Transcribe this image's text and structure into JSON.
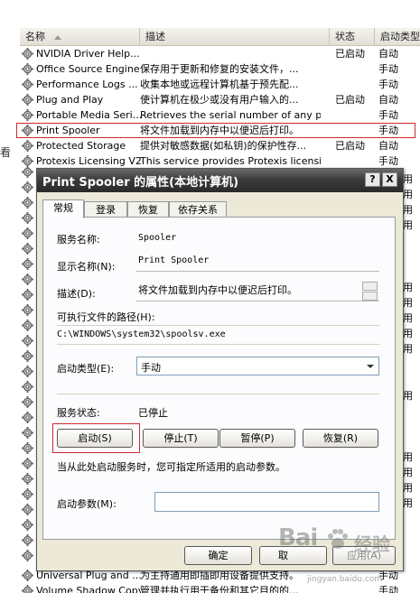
{
  "edge_char": "看",
  "columns": {
    "name": "名称",
    "desc": "描述",
    "status": "状态",
    "startup": "启动类型"
  },
  "rows": [
    {
      "name": "NVIDIA Driver Help...",
      "desc": "",
      "status": "已启动",
      "startup": "自动"
    },
    {
      "name": "Office Source Engine",
      "desc": "保存用于更新和修复的安装文件，...",
      "status": "",
      "startup": "手动"
    },
    {
      "name": "Performance Logs ...",
      "desc": "收集本地或远程计算机基于预先配...",
      "status": "",
      "startup": "手动"
    },
    {
      "name": "Plug and Play",
      "desc": "使计算机在极少或没有用户输入的...",
      "status": "已启动",
      "startup": "自动"
    },
    {
      "name": "Portable Media Seri...",
      "desc": "Retrieves the serial number of any port...",
      "status": "",
      "startup": "手动"
    },
    {
      "name": "Print Spooler",
      "desc": "将文件加载到内存中以便迟后打印。",
      "status": "",
      "startup": "手动"
    },
    {
      "name": "Protected Storage",
      "desc": "提供对敏感数据(如私钥)的保护性存...",
      "status": "已启动",
      "startup": "自动"
    },
    {
      "name": "Protexis Licensing V2",
      "desc": "This service provides Protexis licensing ...",
      "status": "",
      "startup": "手动"
    }
  ],
  "bottom_rows": [
    {
      "name": "Universal Plug and ...",
      "desc": "为主持通用即插即用设备提供支持。",
      "startup": "手动"
    },
    {
      "name": "Volume Shadow Copy",
      "desc": "管理并执行用于备份和其它目的的...",
      "startup": "手动"
    }
  ],
  "right_strip": [
    "用",
    "用",
    "用",
    "用",
    "用",
    "用",
    "用",
    "用",
    "用",
    "用",
    "用",
    "用",
    "用",
    "用"
  ],
  "dialog": {
    "title": "Print Spooler 的属性(本地计算机)",
    "help_btn": "?",
    "close_btn": "X",
    "tabs": [
      "常规",
      "登录",
      "恢复",
      "依存关系"
    ],
    "service_name_label": "服务名称:",
    "service_name": "Spooler",
    "display_name_label": "显示名称(N):",
    "display_name": "Print Spooler",
    "description_label": "描述(D):",
    "description": "将文件加载到内存中以便迟后打印。",
    "exe_path_label": "可执行文件的路径(H):",
    "exe_path": "C:\\WINDOWS\\system32\\spoolsv.exe",
    "startup_type_label": "启动类型(E):",
    "startup_type": "手动",
    "service_status_label": "服务状态:",
    "service_status": "已停止",
    "buttons": {
      "start": "启动(S)",
      "stop": "停止(T)",
      "pause": "暂停(P)",
      "resume": "恢复(R)"
    },
    "hint": "当从此处启动服务时，您可指定所适用的启动参数。",
    "start_params_label": "启动参数(M):",
    "start_params": "",
    "ok": "确定",
    "cancel": "取",
    "apply": "应用(A)"
  },
  "watermark": {
    "text": "Bai",
    "text2": "经验",
    "sub": "jingyan.baidu.com"
  }
}
